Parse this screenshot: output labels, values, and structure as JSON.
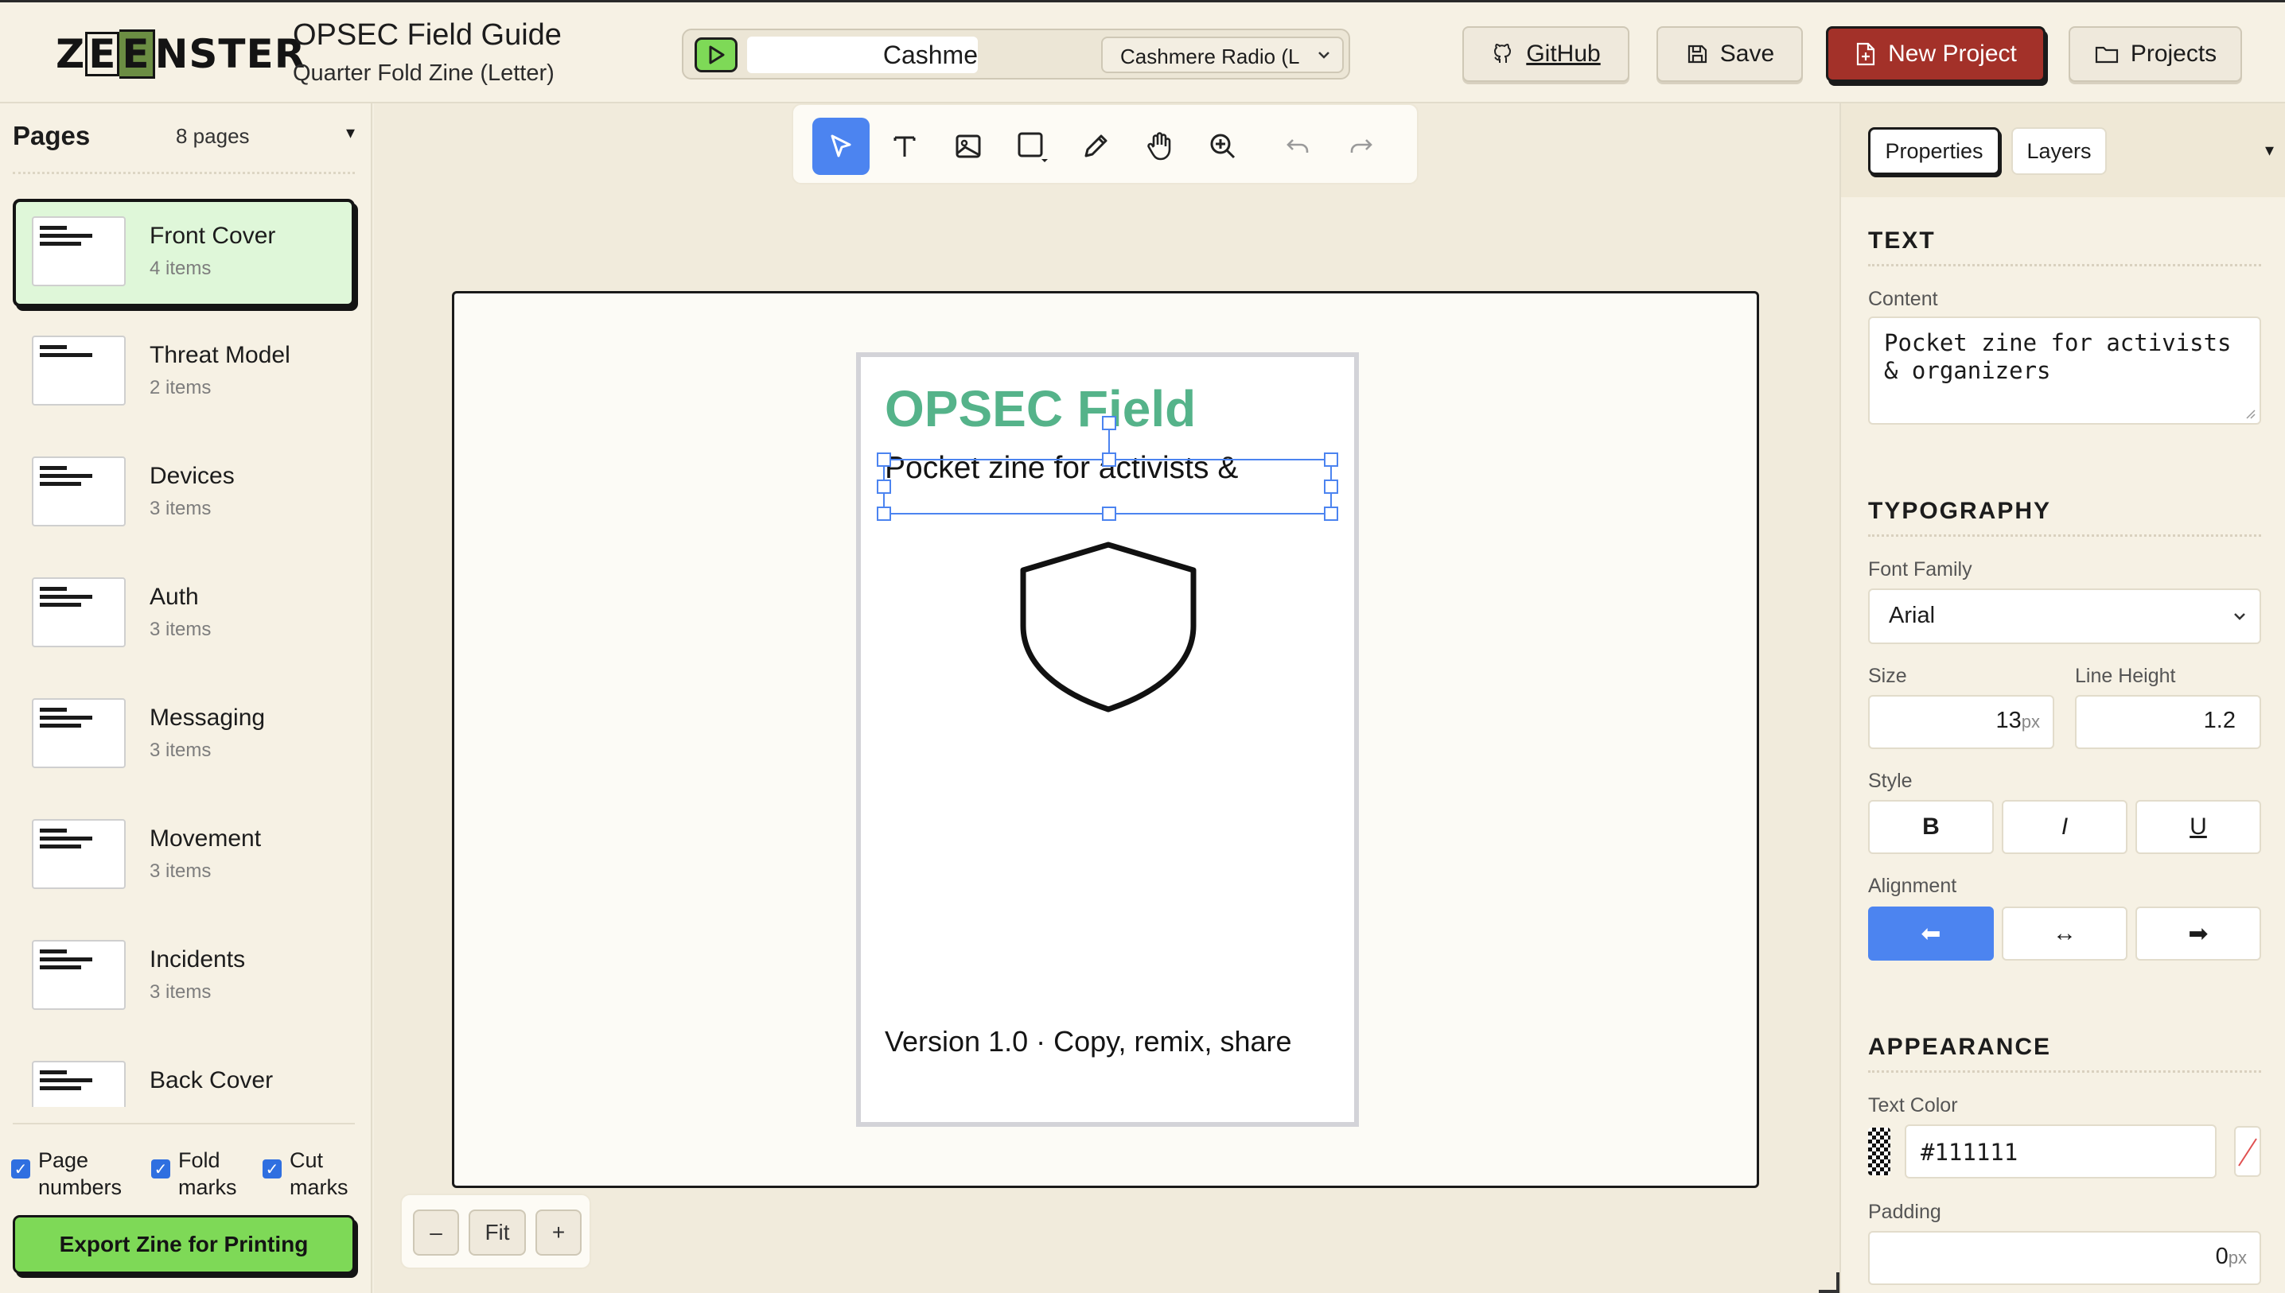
{
  "app": {
    "logo": "ZEENSTER",
    "doc_title": "OPSEC Field Guide",
    "doc_subtitle": "Quarter Fold Zine (Letter)"
  },
  "player": {
    "track": "Cashme",
    "station": "Cashmere Radio (L"
  },
  "header_buttons": {
    "github": "GitHub",
    "save": "Save",
    "new_project": "New Project",
    "projects": "Projects"
  },
  "pages_panel": {
    "title": "Pages",
    "count": "8 pages",
    "pages": [
      {
        "name": "Front Cover",
        "items": "4 items"
      },
      {
        "name": "Threat Model",
        "items": "2 items"
      },
      {
        "name": "Devices",
        "items": "3 items"
      },
      {
        "name": "Auth",
        "items": "3 items"
      },
      {
        "name": "Messaging",
        "items": "3 items"
      },
      {
        "name": "Movement",
        "items": "3 items"
      },
      {
        "name": "Incidents",
        "items": "3 items"
      },
      {
        "name": "Back Cover",
        "items": ""
      }
    ],
    "options": [
      {
        "label1": "Page",
        "label2": "numbers",
        "checked": true
      },
      {
        "label1": "Fold",
        "label2": "marks",
        "checked": true
      },
      {
        "label1": "Cut",
        "label2": "marks",
        "checked": true
      }
    ],
    "export_label": "Export Zine for Printing"
  },
  "toolbar": {
    "tools": [
      "select",
      "text",
      "image",
      "shape",
      "pen",
      "pan",
      "zoom",
      "undo",
      "redo"
    ],
    "active_tool": "select"
  },
  "zine_page": {
    "title": "OPSEC Field",
    "subtitle": "Pocket zine for activists &",
    "footer": "Version 1.0 · Copy, remix, share",
    "title_color": "#55b38a"
  },
  "zoom": {
    "minus": "–",
    "fit": "Fit",
    "plus": "+"
  },
  "properties": {
    "tabs": [
      "Properties",
      "Layers"
    ],
    "active_tab": "Properties",
    "text_section": "TEXT",
    "content_label": "Content",
    "content_line1": "Pocket zine for activists",
    "content_line2": "& organizers",
    "typography_section": "TYPOGRAPHY",
    "font_family_label": "Font Family",
    "font_family_value": "Arial",
    "size_label": "Size",
    "size_value": "13",
    "size_unit": "px",
    "line_height_label": "Line Height",
    "line_height_value": "1.2",
    "style_label": "Style",
    "style_bold": "B",
    "style_italic": "I",
    "style_underline": "U",
    "alignment_label": "Alignment",
    "align_left": "⬅",
    "align_center": "↔",
    "align_right": "➡",
    "alignment_active": "left",
    "appearance_section": "APPEARANCE",
    "text_color_label": "Text Color",
    "text_color_value": "#111111",
    "padding_label": "Padding",
    "padding_value": "0",
    "padding_unit": "px"
  },
  "colors": {
    "accent_green": "#7ed957",
    "new_project_red": "#a33129",
    "selection_blue": "#4c84f0",
    "background_cream": "#f4efe2"
  }
}
